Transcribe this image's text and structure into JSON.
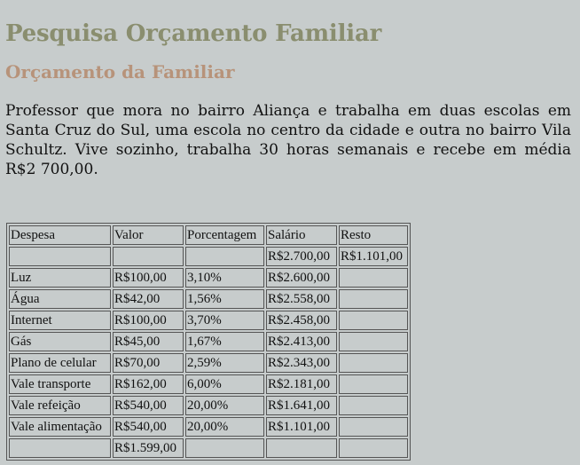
{
  "title": "Pesquisa Orçamento Familiar",
  "subtitle": "Orçamento da Familiar",
  "intro": "Professor que mora no bairro Aliança e trabalha em duas escolas em Santa Cruz do Sul, uma escola no centro da cidade e outra no bairro Vila Schultz. Vive sozinho, trabalha 30 horas semanais e recebe em média R$2 700,00.",
  "table": {
    "headers": [
      "Despesa",
      "Valor",
      "Porcentagem",
      "Salário",
      "Resto"
    ],
    "rows": [
      [
        "",
        "",
        "",
        "R$2.700,00",
        "R$1.101,00"
      ],
      [
        "Luz",
        "R$100,00",
        "3,10%",
        "R$2.600,00",
        ""
      ],
      [
        "Água",
        "R$42,00",
        "1,56%",
        "R$2.558,00",
        ""
      ],
      [
        "Internet",
        "R$100,00",
        "3,70%",
        "R$2.458,00",
        ""
      ],
      [
        "Gás",
        "R$45,00",
        "1,67%",
        "R$2.413,00",
        ""
      ],
      [
        "Plano de celular",
        "R$70,00",
        "2,59%",
        "R$2.343,00",
        ""
      ],
      [
        "Vale transporte",
        "R$162,00",
        "6,00%",
        "R$2.181,00",
        ""
      ],
      [
        "Vale refeição",
        "R$540,00",
        "20,00%",
        "R$1.641,00",
        ""
      ],
      [
        "Vale alimentação",
        "R$540,00",
        "20,00%",
        "R$1.101,00",
        ""
      ],
      [
        "",
        "R$1.599,00",
        "",
        "",
        ""
      ]
    ]
  }
}
